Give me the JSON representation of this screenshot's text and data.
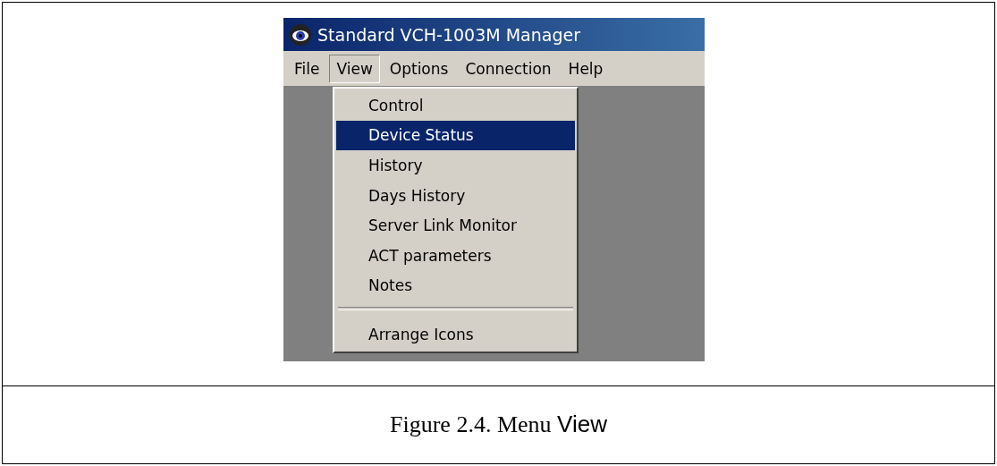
{
  "window": {
    "title": "Standard VCH-1003M Manager"
  },
  "menubar": [
    {
      "label": "File",
      "selected": false
    },
    {
      "label": "View",
      "selected": true
    },
    {
      "label": "Options",
      "selected": false
    },
    {
      "label": "Connection",
      "selected": false
    },
    {
      "label": "Help",
      "selected": false
    }
  ],
  "menu": [
    {
      "kind": "item",
      "label": "Control",
      "selected": false
    },
    {
      "kind": "item",
      "label": "Device Status",
      "selected": true
    },
    {
      "kind": "item",
      "label": "History",
      "selected": false
    },
    {
      "kind": "item",
      "label": "Days History",
      "selected": false
    },
    {
      "kind": "item",
      "label": "Server Link Monitor",
      "selected": false
    },
    {
      "kind": "item",
      "label": "ACT parameters",
      "selected": false
    },
    {
      "kind": "item",
      "label": "Notes",
      "selected": false
    },
    {
      "kind": "separator"
    },
    {
      "kind": "item",
      "label": "Arrange Icons",
      "selected": false
    }
  ],
  "caption": {
    "text": "Figure 2.4. Menu",
    "menu_name": "View"
  }
}
